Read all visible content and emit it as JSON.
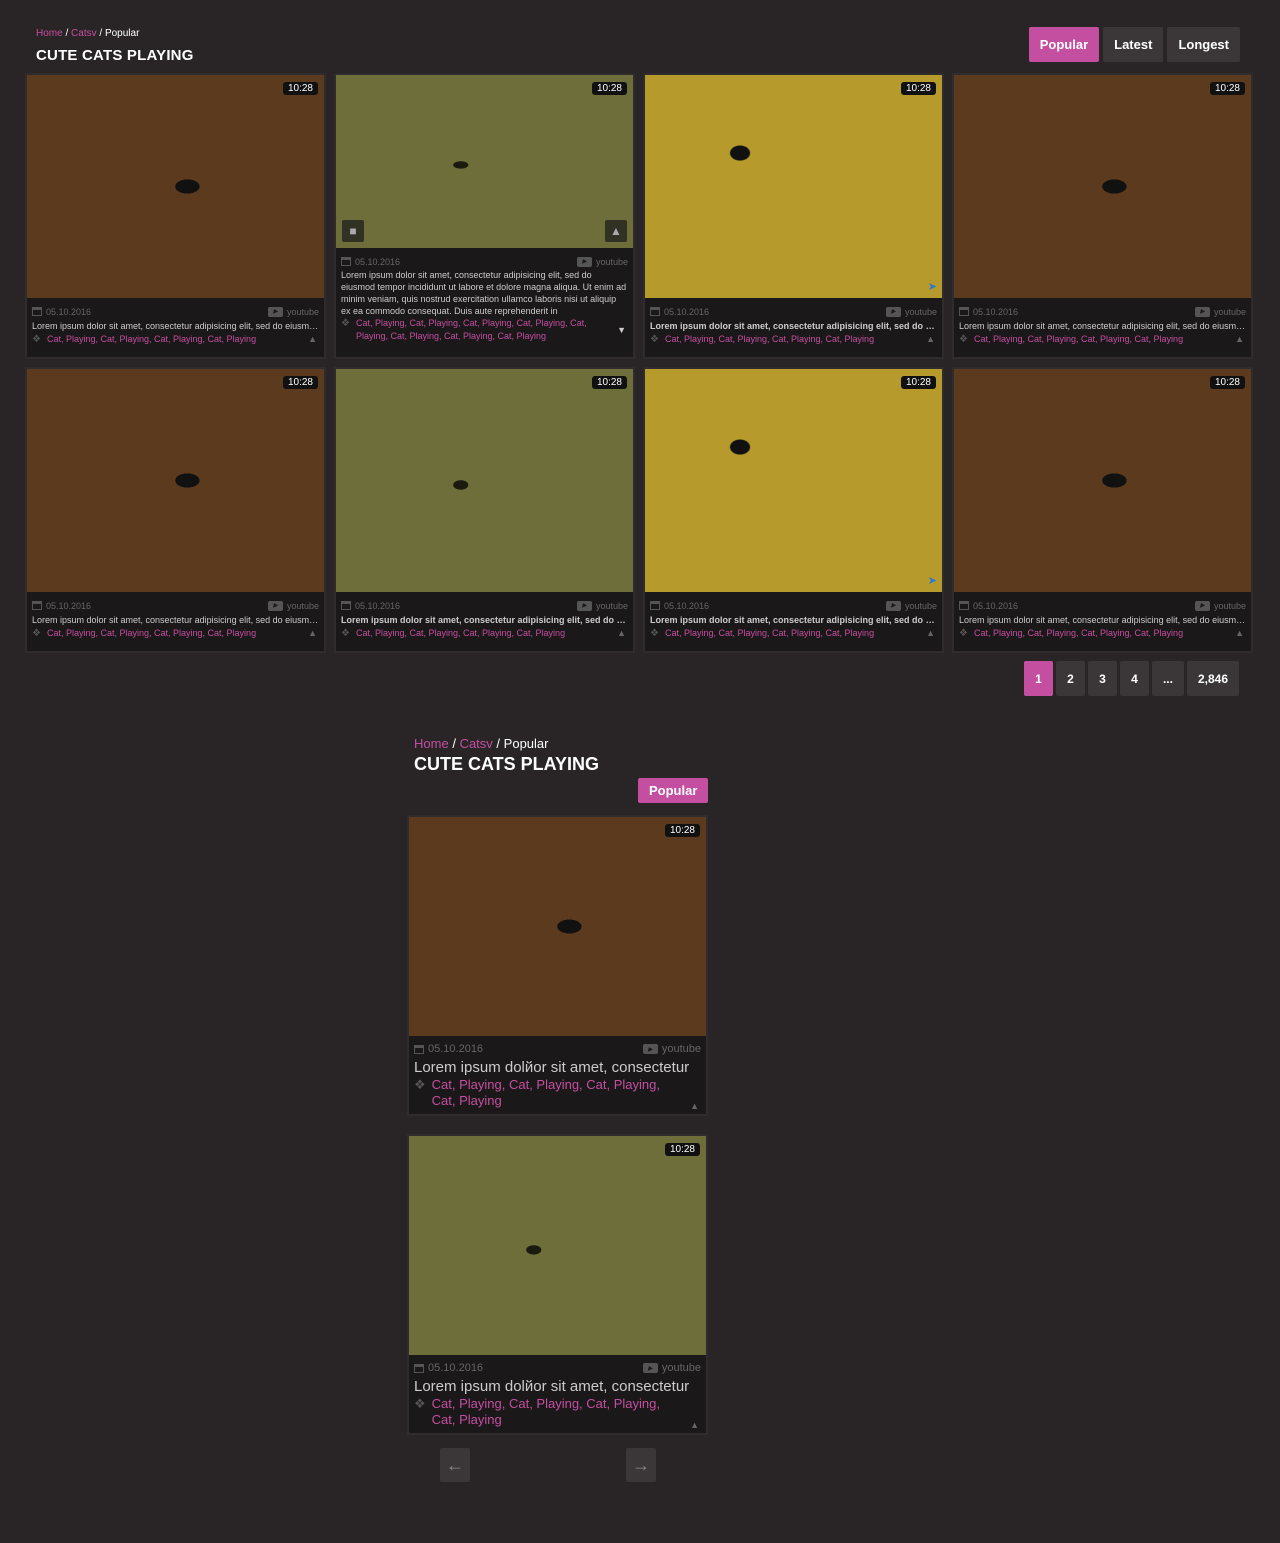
{
  "breadcrumb": {
    "home": "Home",
    "cat": "Catsv",
    "current": "Popular",
    "sep": "/"
  },
  "title": "CUTE CATS PLAYING",
  "sort": {
    "popular": "Popular",
    "latest": "Latest",
    "longest": "Longest",
    "active": "Popular"
  },
  "colors": {
    "accent": "#c44fa0",
    "background": "#292526",
    "card": "#1b1819",
    "button": "#3b3738"
  },
  "videos": [
    {
      "duration": "10:28",
      "date": "05.10.2016",
      "source": "youtube",
      "desc": "Lorem ipsum dolor sit amet, consectetur adipisicing elit, sed do eiusmod tempor incididunt",
      "tags": "Cat, Playing, Cat, Playing, Cat, Playing, Cat, Playing",
      "image": "cat1"
    },
    {
      "duration": "10:28",
      "date": "05.10.2016",
      "source": "youtube",
      "desc": "Lorem ipsum dolor sit amet, consectetur adipisicing elit, sed do eiusmod tempor incididunt ut labore et dolore magna aliqua. Ut enim ad minim veniam, quis nostrud exercitation ullamco laboris nisi ut aliquip ex ea commodo consequat. Duis aute reprehenderit in",
      "tags": "Cat, Playing, Cat, Playing, Cat, Playing, Cat, Playing, Cat, Playing, Cat, Playing, Cat, Playing, Cat, Playing",
      "image": "cat2",
      "expanded": true
    },
    {
      "duration": "10:28",
      "date": "05.10.2016",
      "source": "youtube",
      "desc": "Lorem ipsum dolor sit amet, consectetur adipisicing elit, sed do eiusmod tempor incididunt",
      "tags": "Cat, Playing, Cat, Playing, Cat, Playing, Cat, Playing",
      "image": "cat3",
      "bold": true
    },
    {
      "duration": "10:28",
      "date": "05.10.2016",
      "source": "youtube",
      "desc": "Lorem ipsum dolor sit amet, consectetur adipisicing elit, sed do eiusmod tempor incididunt",
      "tags": "Cat, Playing, Cat, Playing, Cat, Playing, Cat, Playing",
      "image": "cat1"
    },
    {
      "duration": "10:28",
      "date": "05.10.2016",
      "source": "youtube",
      "desc": "Lorem ipsum dolor sit amet, consectetur adipisicing elit, sed do eiusmod tempor incididunt",
      "tags": "Cat, Playing, Cat, Playing, Cat, Playing, Cat, Playing",
      "image": "cat1"
    },
    {
      "duration": "10:28",
      "date": "05.10.2016",
      "source": "youtube",
      "desc": "Lorem ipsum dolor sit amet, consectetur adipisicing elit, sed do eiusmod tempor incididunt",
      "tags": "Cat, Playing, Cat, Playing, Cat, Playing, Cat, Playing",
      "image": "cat2",
      "bold": true
    },
    {
      "duration": "10:28",
      "date": "05.10.2016",
      "source": "youtube",
      "desc": "Lorem ipsum dolor sit amet, consectetur adipisicing elit, sed do eiusmod tempor incididunt",
      "tags": "Cat, Playing, Cat, Playing, Cat, Playing, Cat, Playing",
      "image": "cat3",
      "bold": true
    },
    {
      "duration": "10:28",
      "date": "05.10.2016",
      "source": "youtube",
      "desc": "Lorem ipsum dolor sit amet, consectetur adipisicing elit, sed do eiusmod tempor incididunt",
      "tags": "Cat, Playing, Cat, Playing, Cat, Playing, Cat, Playing",
      "image": "cat1"
    }
  ],
  "pagination": [
    "1",
    "2",
    "3",
    "4",
    "...",
    "2,846"
  ],
  "mobile": {
    "breadcrumb": {
      "home": "Home",
      "cat": "Catsv",
      "current": "Popular"
    },
    "title": "CUTE CATS PLAYING",
    "sort_label": "Popular",
    "videos": [
      {
        "duration": "10:28",
        "date": "05.10.2016",
        "source": "youtube",
        "desc": "Lorem ipsum dolйor sit amet, consectetur",
        "tags": "Cat, Playing, Cat, Playing, Cat, Playing, Cat, Playing",
        "image": "cat1"
      },
      {
        "duration": "10:28",
        "date": "05.10.2016",
        "source": "youtube",
        "desc": "Lorem ipsum dolйor sit amet, consectetur",
        "tags": "Cat, Playing, Cat, Playing, Cat, Playing, Cat, Playing",
        "image": "cat2"
      }
    ],
    "prev_icon": "arrow-left-icon",
    "next_icon": "arrow-right-icon"
  },
  "icons": {
    "calendar": "calendar-icon",
    "youtube": "youtube-icon",
    "tag": "tag-icon",
    "trash": "trash-icon",
    "like": "thumbs-up-icon",
    "toggle": "chevron-icon"
  }
}
